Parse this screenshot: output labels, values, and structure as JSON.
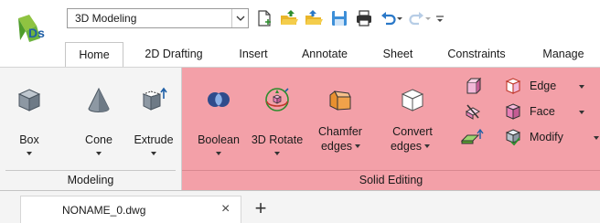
{
  "quick_access": {
    "workspace": "3D Modeling",
    "icons": [
      "new-icon",
      "open-icon",
      "open-sheet-icon",
      "save-icon",
      "print-icon",
      "undo-icon",
      "redo-icon",
      "customize-icon"
    ]
  },
  "tabs": [
    {
      "label": "Home",
      "active": true
    },
    {
      "label": "2D Drafting"
    },
    {
      "label": "Insert"
    },
    {
      "label": "Annotate"
    },
    {
      "label": "Sheet"
    },
    {
      "label": "Constraints"
    },
    {
      "label": "Manage"
    }
  ],
  "modeling_panel": {
    "title": "Modeling",
    "buttons": [
      {
        "label": "Box",
        "icon": "box-icon"
      },
      {
        "label": "Cone",
        "icon": "cone-icon"
      },
      {
        "label": "Extrude",
        "icon": "extrude-icon"
      }
    ]
  },
  "solid_panel": {
    "title": "Solid Editing",
    "accent": "#f3a0a8",
    "buttons": [
      {
        "label": "Boolean",
        "icon": "boolean-icon"
      },
      {
        "label": "3D Rotate",
        "icon": "3d-rotate-icon"
      },
      {
        "label_1": "Chamfer",
        "label_2": "edges",
        "icon": "chamfer-edges-icon"
      },
      {
        "label_1": "Convert",
        "label_2": "edges",
        "icon": "convert-edges-icon"
      }
    ],
    "small_buttons": [
      {
        "label": "Edge",
        "icon": "edge-icon"
      },
      {
        "label": "Face",
        "icon": "face-icon"
      },
      {
        "label": "Modify",
        "icon": "modify-icon"
      }
    ]
  },
  "document": {
    "file_name": "NONAME_0.dwg",
    "close_glyph": "×",
    "add_glyph": "+"
  }
}
